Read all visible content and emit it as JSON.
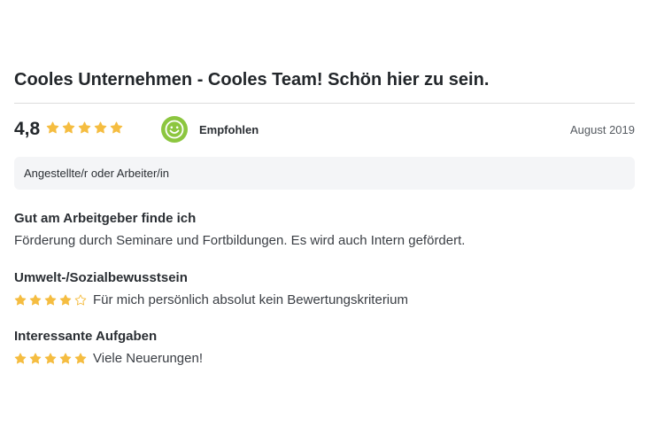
{
  "review": {
    "title": "Cooles Unternehmen - Cooles Team! Schön hier zu sein.",
    "score": "4,8",
    "overall_stars": [
      "full",
      "full",
      "full",
      "full",
      "full"
    ],
    "recommendation": "Empfohlen",
    "date": "August 2019",
    "position": "Angestellte/r oder Arbeiter/in",
    "sections": [
      {
        "title": "Gut am Arbeitgeber finde ich",
        "text": "Förderung durch Seminare und Fortbildungen. Es wird auch Intern gefördert."
      },
      {
        "title": "Umwelt-/Sozialbewusstsein",
        "stars": [
          "full",
          "full",
          "full",
          "full",
          "empty"
        ],
        "text": "Für mich persönlich absolut kein Bewertungskriterium"
      },
      {
        "title": "Interessante Aufgaben",
        "stars": [
          "full",
          "full",
          "full",
          "full",
          "full"
        ],
        "text": "Viele Neuerungen!"
      }
    ]
  },
  "colors": {
    "star": "#f5bd41",
    "recommend": "#8cc63f",
    "divider": "#dddddd",
    "box_bg": "#f4f5f7"
  },
  "icons": {
    "star": "star-icon",
    "recommend": "smiley-icon"
  }
}
